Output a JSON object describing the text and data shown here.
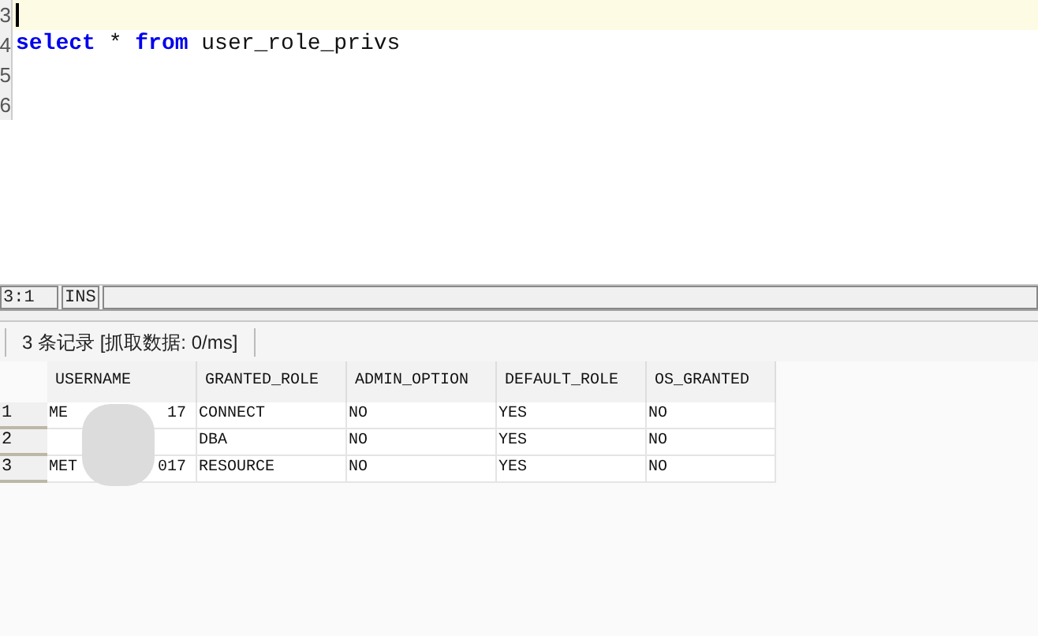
{
  "editor": {
    "lines": [
      {
        "number": "3",
        "current": true
      },
      {
        "number": "4",
        "text": "select * from user_role_privs",
        "current": false
      },
      {
        "number": "5",
        "current": false
      },
      {
        "number": "6",
        "current": false
      }
    ]
  },
  "status_bar": {
    "position": "3:1",
    "mode": "INS"
  },
  "result_summary": "3 条记录 [抓取数据: 0/ms]",
  "table": {
    "columns": [
      "USERNAME",
      "GRANTED_ROLE",
      "ADMIN_OPTION",
      "DEFAULT_ROLE",
      "OS_GRANTED"
    ],
    "rows": [
      {
        "number": "1",
        "cells": [
          {
            "start": "ME",
            "end": "17"
          },
          "CONNECT",
          "NO",
          "YES",
          "NO"
        ]
      },
      {
        "number": "2",
        "cells": [
          null,
          "DBA",
          "NO",
          "YES",
          "NO"
        ]
      },
      {
        "number": "3",
        "cells": [
          {
            "start": "MET",
            "end": "017"
          },
          "RESOURCE",
          "NO",
          "YES",
          "NO"
        ]
      }
    ]
  }
}
